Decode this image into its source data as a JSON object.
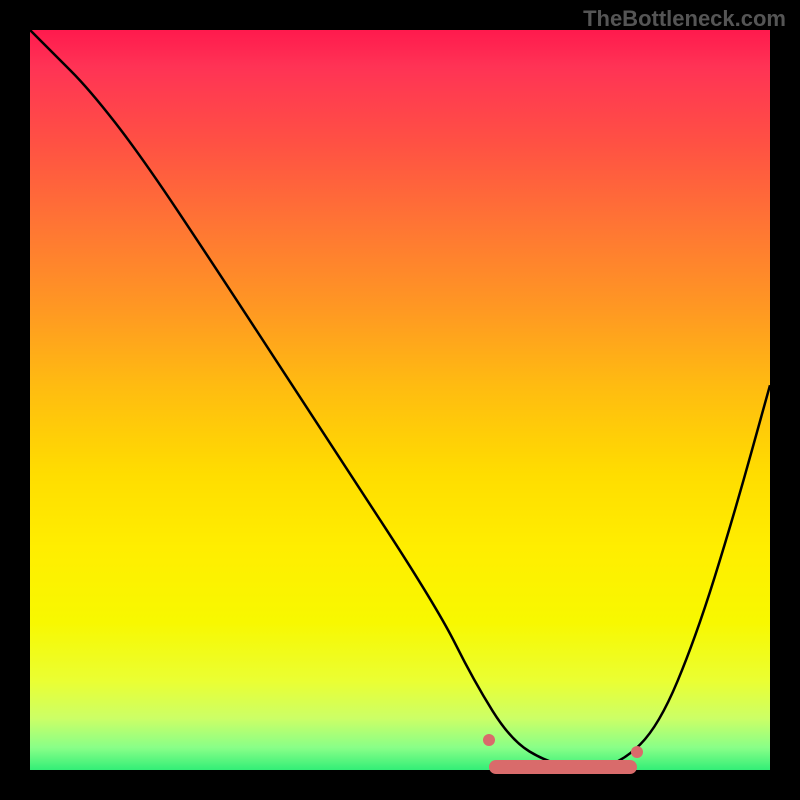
{
  "watermark": "TheBottleneck.com",
  "chart_data": {
    "type": "line",
    "title": "",
    "xlabel": "",
    "ylabel": "",
    "xlim": [
      0,
      100
    ],
    "ylim": [
      0,
      100
    ],
    "grid": false,
    "legend": false,
    "series": [
      {
        "name": "bottleneck-curve",
        "x": [
          0,
          3,
          8,
          15,
          25,
          40,
          55,
          60,
          65,
          70,
          75,
          80,
          85,
          90,
          95,
          100
        ],
        "values": [
          100,
          97,
          92,
          83,
          68,
          45,
          22,
          12,
          4,
          1,
          0,
          1,
          6,
          18,
          34,
          52
        ]
      }
    ],
    "highlight": {
      "name": "optimal-range",
      "x_start": 62,
      "x_end": 82,
      "y": 0,
      "segment": [
        {
          "x": 62,
          "y": 4
        },
        {
          "x": 66,
          "y": 1.5
        },
        {
          "x": 72,
          "y": 0.2
        },
        {
          "x": 78,
          "y": 0.4
        },
        {
          "x": 82,
          "y": 2.5
        }
      ]
    },
    "gradient_stops": [
      {
        "pos": 0,
        "color": "#ff1a4d"
      },
      {
        "pos": 50,
        "color": "#ffcc00"
      },
      {
        "pos": 100,
        "color": "#33ee77"
      }
    ]
  }
}
